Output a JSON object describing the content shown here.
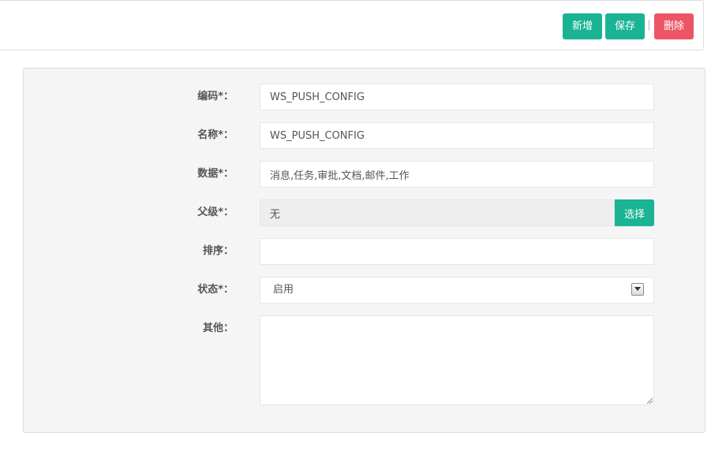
{
  "toolbar": {
    "add_label": "新增",
    "save_label": "保存",
    "delete_label": "删除"
  },
  "form": {
    "code": {
      "label": "编码*：",
      "value": "WS_PUSH_CONFIG"
    },
    "name": {
      "label": "名称*：",
      "value": "WS_PUSH_CONFIG"
    },
    "data": {
      "label": "数据*：",
      "value": "消息,任务,审批,文档,邮件,工作"
    },
    "parent": {
      "label": "父级*：",
      "value": "无",
      "button_label": "选择"
    },
    "sort": {
      "label": "排序：",
      "value": ""
    },
    "status": {
      "label": "状态*：",
      "selected": "启用"
    },
    "other": {
      "label": "其他：",
      "value": ""
    }
  },
  "colors": {
    "primary": "#1ab394",
    "danger": "#ed5565",
    "panel_bg": "#f5f5f5"
  }
}
